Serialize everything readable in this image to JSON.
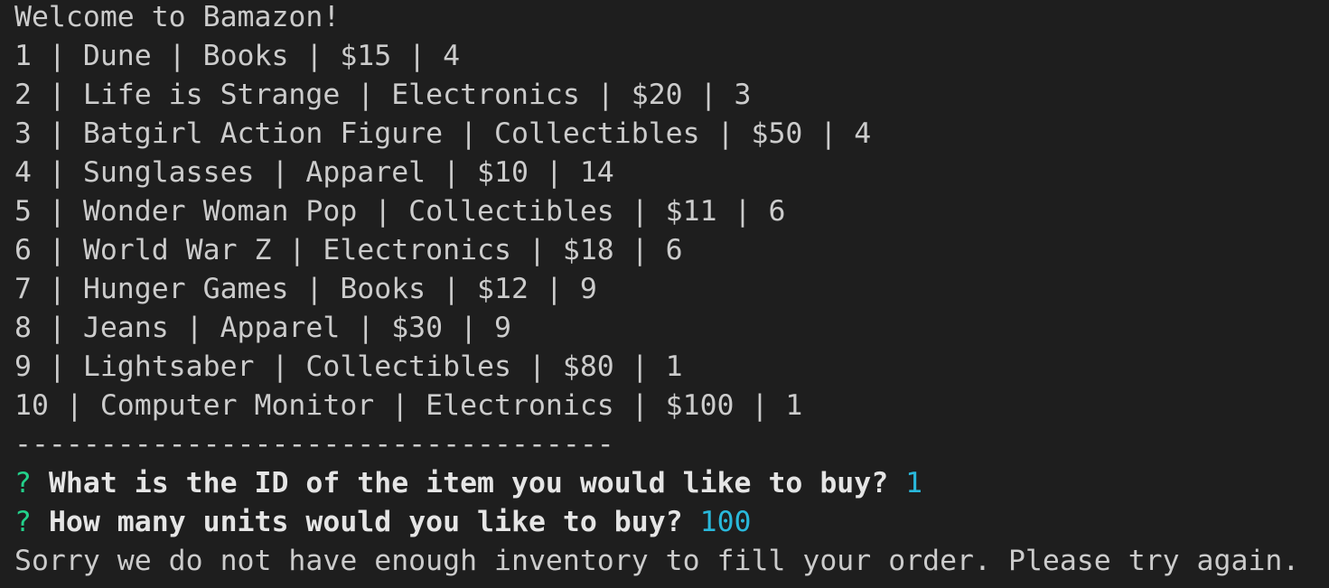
{
  "terminal": {
    "welcome": "Welcome to Bamazon!",
    "products": [
      "1 | Dune | Books | $15 | 4",
      "2 | Life is Strange | Electronics | $20 | 3",
      "3 | Batgirl Action Figure | Collectibles | $50 | 4",
      "4 | Sunglasses | Apparel | $10 | 14",
      "5 | Wonder Woman Pop | Collectibles | $11 | 6",
      "6 | World War Z | Electronics | $18 | 6",
      "7 | Hunger Games | Books | $12 | 9",
      "8 | Jeans | Apparel | $30 | 9",
      "9 | Lightsaber | Collectibles | $80 | 1",
      "10 | Computer Monitor | Electronics | $100 | 1"
    ],
    "separator": "-----------------------------------",
    "prompts": [
      {
        "mark": "?",
        "question": "What is the ID of the item you would like to buy?",
        "answer": "1"
      },
      {
        "mark": "?",
        "question": "How many units would you like to buy?",
        "answer": "100"
      }
    ],
    "message": "Sorry we do not have enough inventory to fill your order. Please try again.",
    "colors": {
      "background": "#1e1e1e",
      "text": "#cccccc",
      "prompt_mark": "#23d18b",
      "answer": "#29b8db"
    }
  }
}
